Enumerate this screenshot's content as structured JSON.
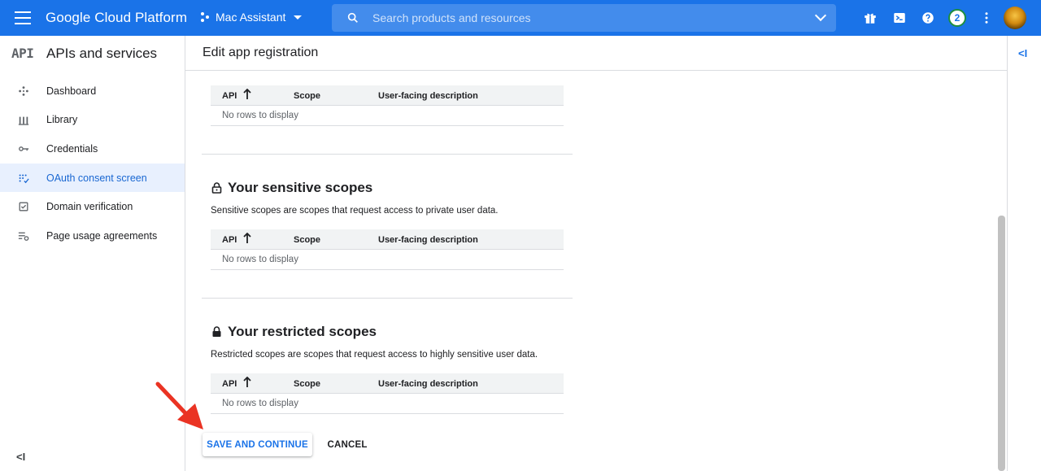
{
  "topbar": {
    "brand": "Google Cloud Platform",
    "project": "Mac Assistant",
    "search_placeholder": "Search products and resources",
    "notification_count": "2",
    "icons": [
      "hamburger-icon",
      "gift-icon",
      "terminal-icon",
      "help-icon",
      "more-vert-icon"
    ]
  },
  "sidebar": {
    "logo": "API",
    "title": "APIs and services",
    "items": [
      {
        "label": "Dashboard",
        "icon": "dashboard-icon",
        "active": false
      },
      {
        "label": "Library",
        "icon": "library-icon",
        "active": false
      },
      {
        "label": "Credentials",
        "icon": "key-icon",
        "active": false
      },
      {
        "label": "OAuth consent screen",
        "icon": "consent-icon",
        "active": true
      },
      {
        "label": "Domain verification",
        "icon": "checkbox-icon",
        "active": false
      },
      {
        "label": "Page usage agreements",
        "icon": "settings-list-icon",
        "active": false
      }
    ],
    "collapse": "<I"
  },
  "main": {
    "title": "Edit app registration",
    "expand": "<I",
    "tables": {
      "headers": {
        "api": "API",
        "scope": "Scope",
        "description": "User-facing description"
      },
      "empty_text": "No rows to display"
    },
    "sections": [
      {
        "title": "Your sensitive scopes",
        "description": "Sensitive scopes are scopes that request access to private user data."
      },
      {
        "title": "Your restricted scopes",
        "description": "Restricted scopes are scopes that request access to highly sensitive user data."
      }
    ],
    "buttons": {
      "save": "SAVE AND CONTINUE",
      "cancel": "CANCEL"
    }
  },
  "colors": {
    "primary": "#1a73e8",
    "active_bg": "#e8f0fe",
    "annotation_arrow": "#ea3323"
  }
}
